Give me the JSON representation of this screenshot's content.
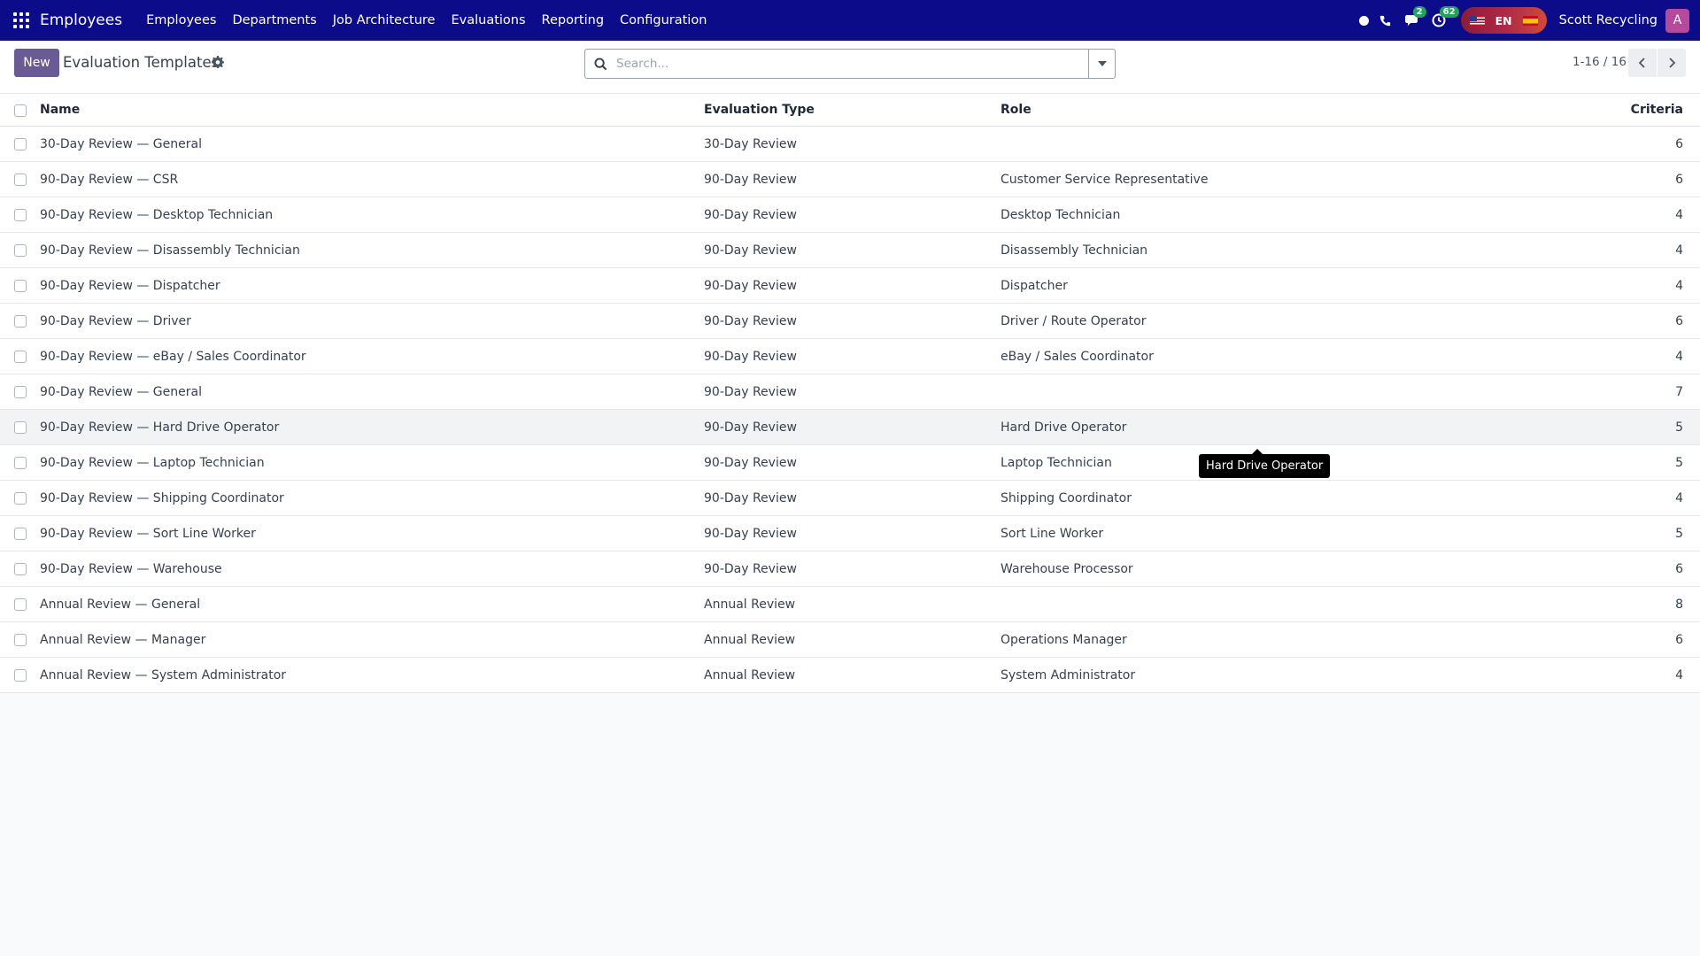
{
  "navbar": {
    "app_name": "Employees",
    "menu": [
      "Employees",
      "Departments",
      "Job Architecture",
      "Evaluations",
      "Reporting",
      "Configuration"
    ],
    "messages_badge": "2",
    "activities_badge": "62",
    "language": "EN",
    "company": "Scott Recycling",
    "avatar_initial": "A"
  },
  "control_panel": {
    "new_label": "New",
    "title": "Evaluation Templates",
    "search_placeholder": "Search...",
    "pager": "1-16 / 16"
  },
  "table": {
    "headers": {
      "name": "Name",
      "type": "Evaluation Type",
      "role": "Role",
      "criteria": "Criteria"
    },
    "rows": [
      {
        "name": "30-Day Review — General",
        "type": "30-Day Review",
        "role": "",
        "criteria": "6"
      },
      {
        "name": "90-Day Review — CSR",
        "type": "90-Day Review",
        "role": "Customer Service Representative",
        "criteria": "6"
      },
      {
        "name": "90-Day Review — Desktop Technician",
        "type": "90-Day Review",
        "role": "Desktop Technician",
        "criteria": "4"
      },
      {
        "name": "90-Day Review — Disassembly Technician",
        "type": "90-Day Review",
        "role": "Disassembly Technician",
        "criteria": "4"
      },
      {
        "name": "90-Day Review — Dispatcher",
        "type": "90-Day Review",
        "role": "Dispatcher",
        "criteria": "4"
      },
      {
        "name": "90-Day Review — Driver",
        "type": "90-Day Review",
        "role": "Driver / Route Operator",
        "criteria": "6"
      },
      {
        "name": "90-Day Review — eBay / Sales Coordinator",
        "type": "90-Day Review",
        "role": "eBay / Sales Coordinator",
        "criteria": "4"
      },
      {
        "name": "90-Day Review — General",
        "type": "90-Day Review",
        "role": "",
        "criteria": "7"
      },
      {
        "name": "90-Day Review — Hard Drive Operator",
        "type": "90-Day Review",
        "role": "Hard Drive Operator",
        "criteria": "5"
      },
      {
        "name": "90-Day Review — Laptop Technician",
        "type": "90-Day Review",
        "role": "Laptop Technician",
        "criteria": "5"
      },
      {
        "name": "90-Day Review — Shipping Coordinator",
        "type": "90-Day Review",
        "role": "Shipping Coordinator",
        "criteria": "4"
      },
      {
        "name": "90-Day Review — Sort Line Worker",
        "type": "90-Day Review",
        "role": "Sort Line Worker",
        "criteria": "5"
      },
      {
        "name": "90-Day Review — Warehouse",
        "type": "90-Day Review",
        "role": "Warehouse Processor",
        "criteria": "6"
      },
      {
        "name": "Annual Review — General",
        "type": "Annual Review",
        "role": "",
        "criteria": "8"
      },
      {
        "name": "Annual Review — Manager",
        "type": "Annual Review",
        "role": "Operations Manager",
        "criteria": "6"
      },
      {
        "name": "Annual Review — System Administrator",
        "type": "Annual Review",
        "role": "System Administrator",
        "criteria": "4"
      }
    ]
  },
  "tooltip": {
    "text": "Hard Drive Operator"
  },
  "colors": {
    "navbar_bg": "#0c0c8a",
    "primary_button": "#6b5b95",
    "badge": "#22a35a",
    "avatar": "#b54a9c"
  }
}
